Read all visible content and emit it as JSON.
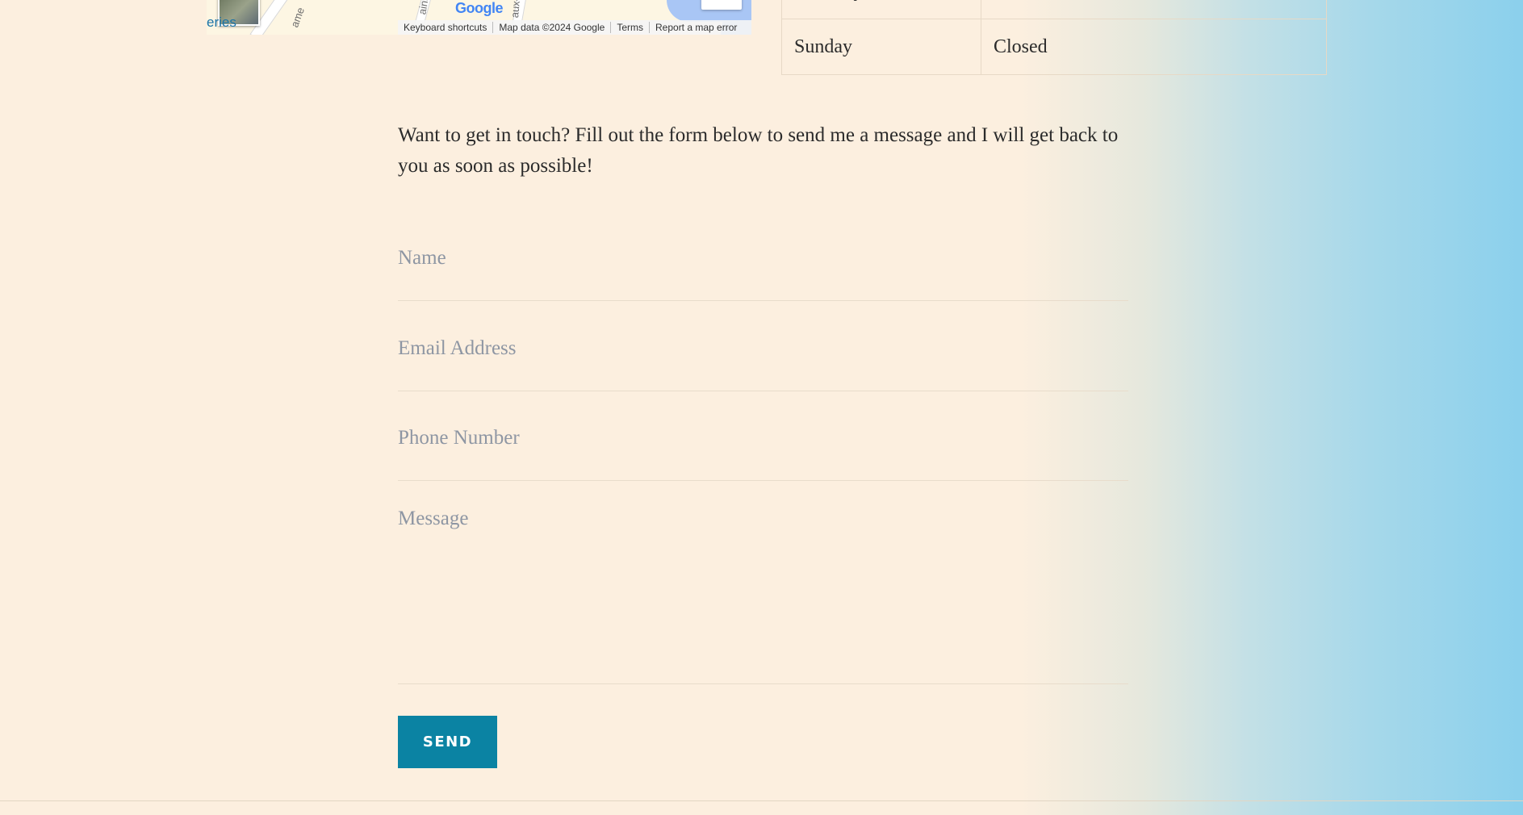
{
  "map": {
    "city_label": "eries",
    "street_labels": [
      "ame",
      "aint",
      "aux-"
    ],
    "logo": "Google",
    "attribution": {
      "keyboard_shortcuts": "Keyboard shortcuts",
      "map_data": "Map data ©2024 Google",
      "terms": "Terms",
      "report": "Report a map error"
    }
  },
  "hours": {
    "rows": [
      {
        "day": "Saturday",
        "hours": ""
      },
      {
        "day": "Sunday",
        "hours": "Closed"
      }
    ]
  },
  "contact": {
    "intro": "Want to get in touch? Fill out the form below to send me a message and I will get back to you as soon as possible!",
    "name_placeholder": "Name",
    "email_placeholder": "Email Address",
    "phone_placeholder": "Phone Number",
    "message_placeholder": "Message",
    "send_label": "SEND"
  },
  "colors": {
    "background": "#fcefdf",
    "accent": "#0b83a3",
    "gradient_end": "#8bd0ec"
  }
}
